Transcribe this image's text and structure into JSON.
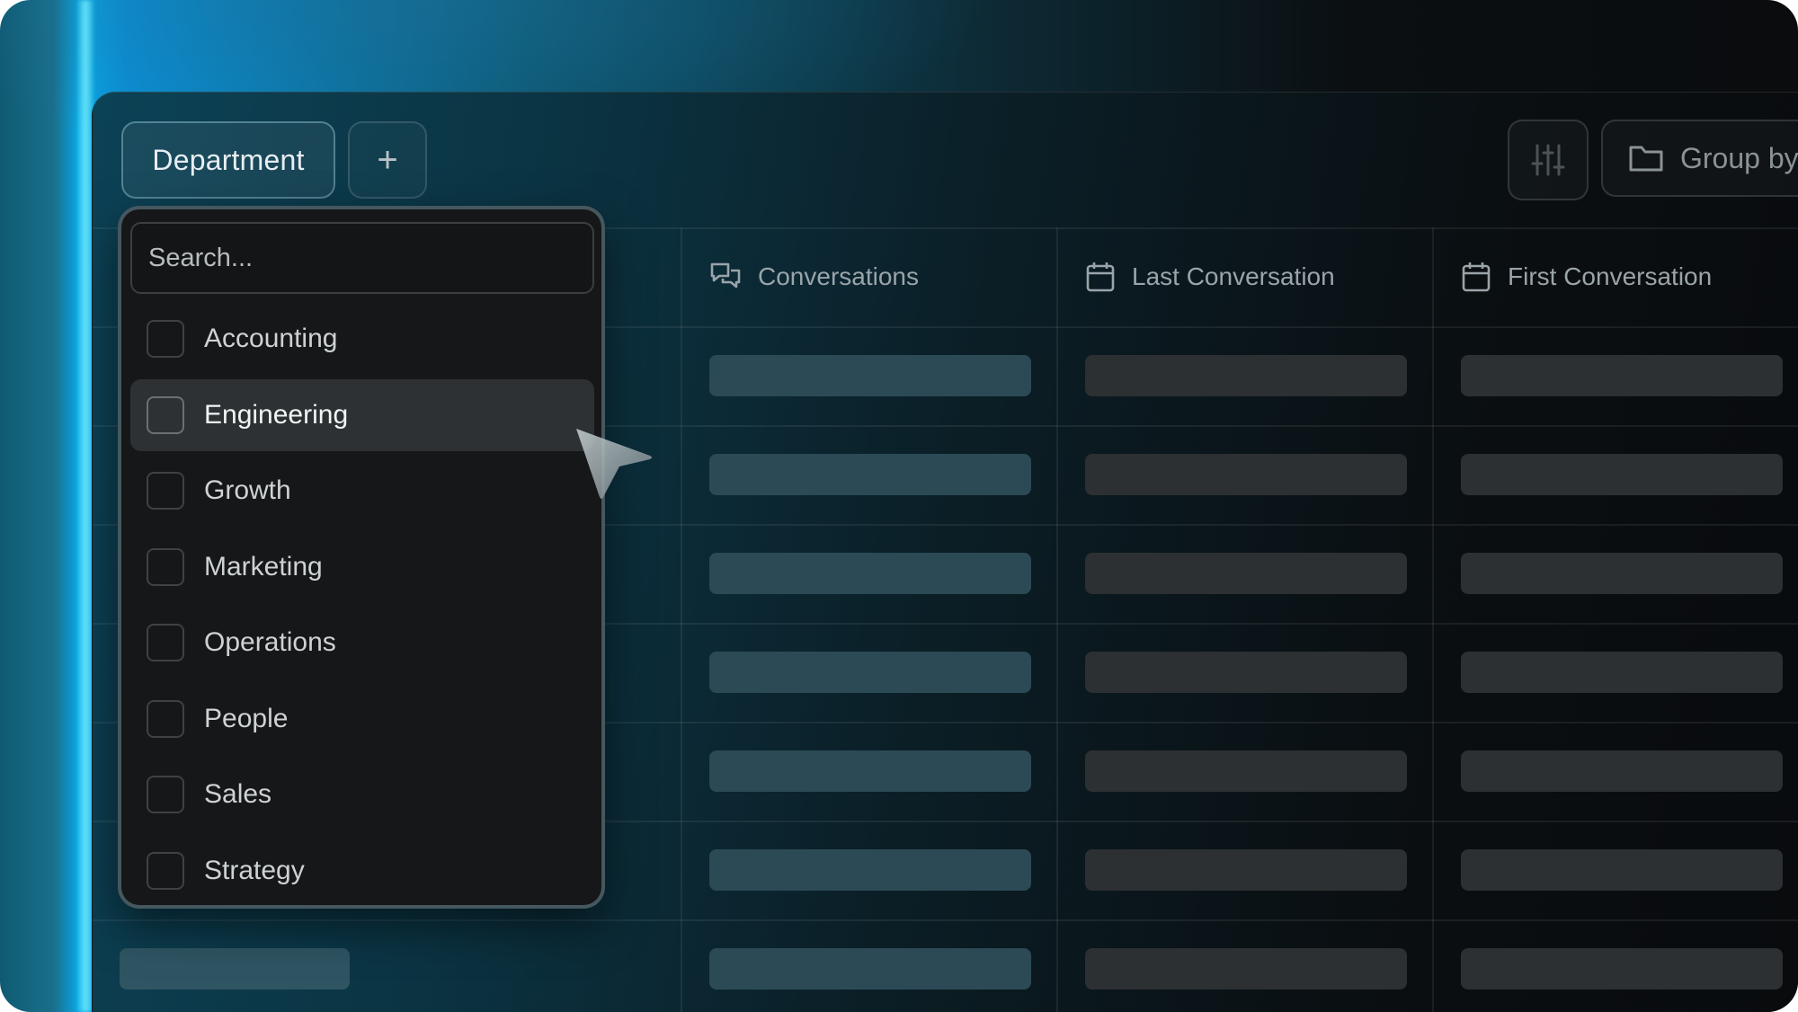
{
  "toolbar": {
    "department_label": "Department",
    "add_symbol": "+",
    "group_by_label": "Group by"
  },
  "columns": [
    {
      "label": "Conversations",
      "icon": "chat-bubbles-icon"
    },
    {
      "label": "Last Conversation",
      "icon": "calendar-icon"
    },
    {
      "label": "First Conversation",
      "icon": "calendar-icon"
    }
  ],
  "dropdown": {
    "search_placeholder": "Search...",
    "options": [
      {
        "label": "Accounting",
        "checked": false,
        "highlighted": false
      },
      {
        "label": "Engineering",
        "checked": false,
        "highlighted": true
      },
      {
        "label": "Growth",
        "checked": false,
        "highlighted": false
      },
      {
        "label": "Marketing",
        "checked": false,
        "highlighted": false
      },
      {
        "label": "Operations",
        "checked": false,
        "highlighted": false
      },
      {
        "label": "People",
        "checked": false,
        "highlighted": false
      },
      {
        "label": "Sales",
        "checked": false,
        "highlighted": false
      },
      {
        "label": "Strategy",
        "checked": false,
        "highlighted": false
      }
    ]
  },
  "colors": {
    "accent_cyan": "#0aa8e6",
    "panel_bg": "#161718",
    "placeholder_teal": "#2b4a55",
    "placeholder_gray": "#2c3032"
  }
}
